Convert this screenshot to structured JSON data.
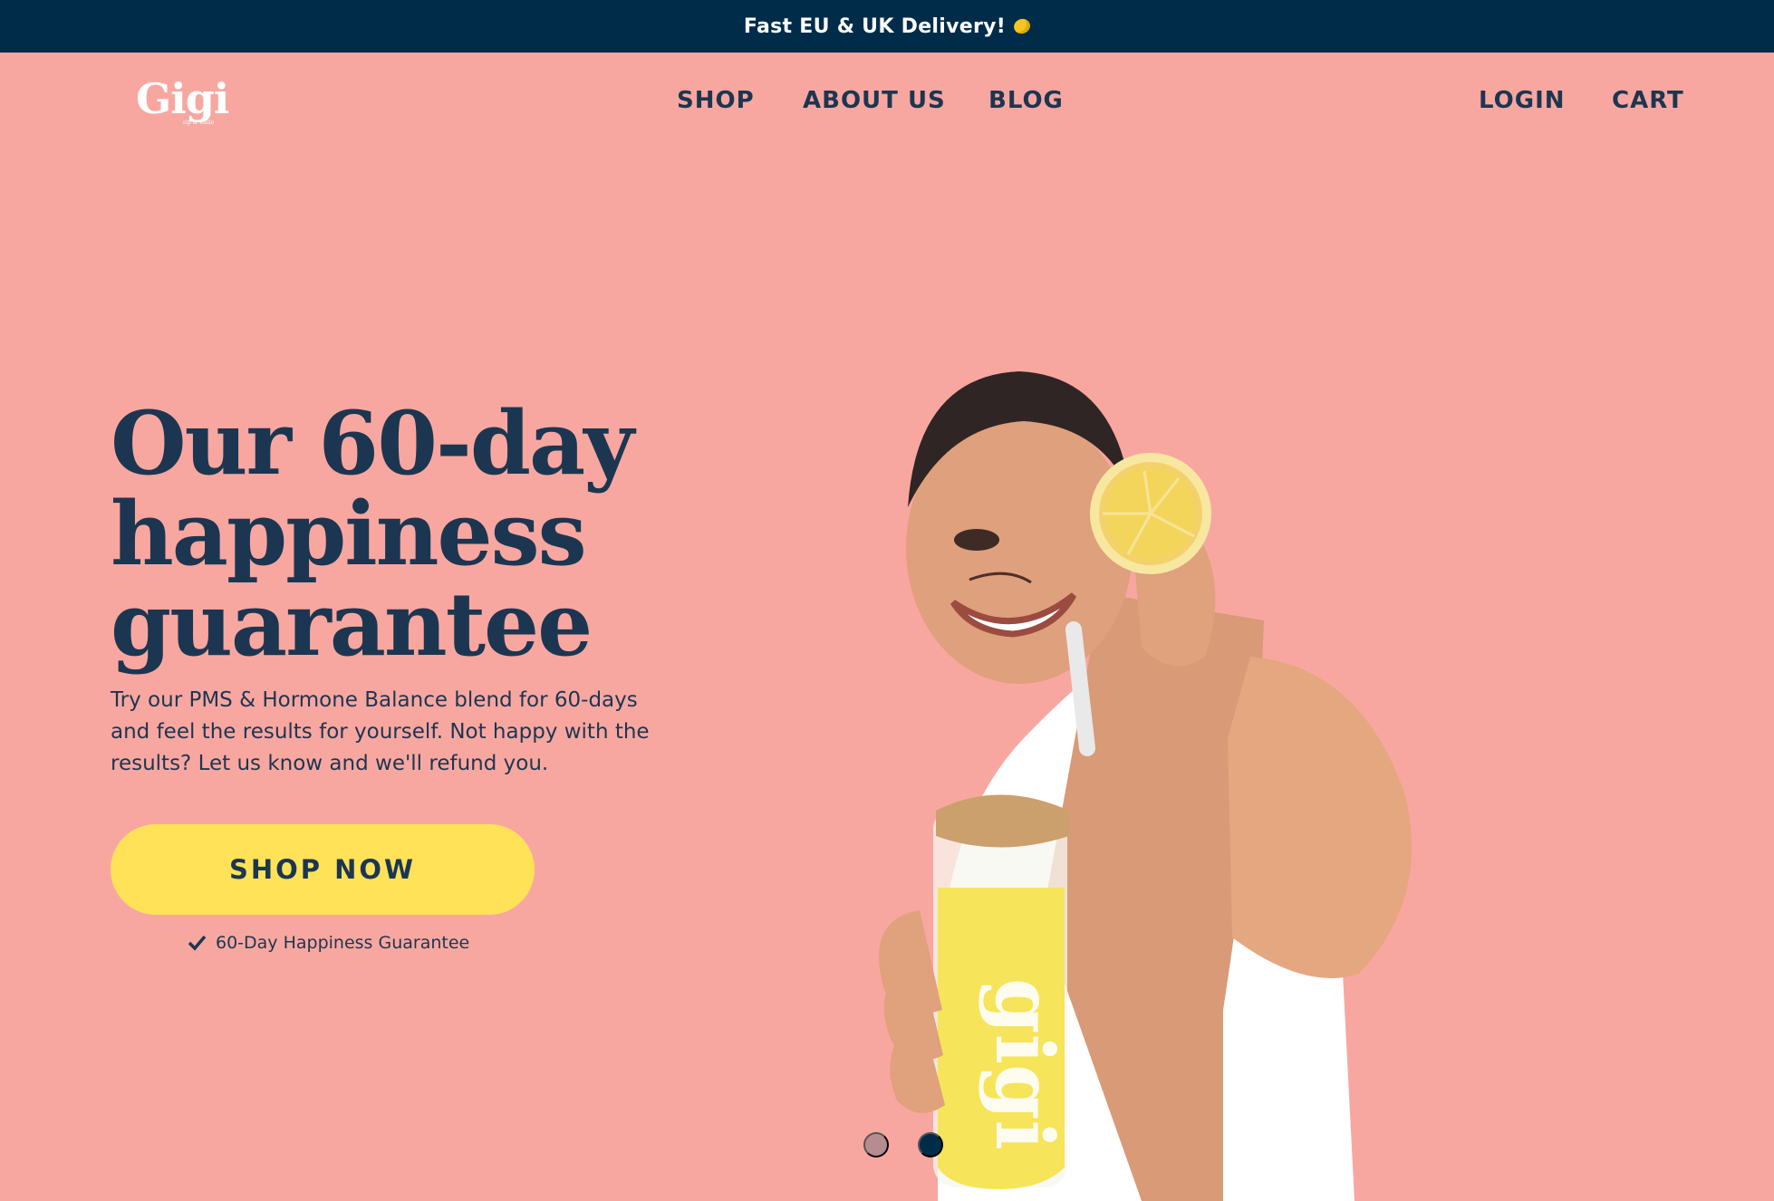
{
  "announcement": {
    "text": "Fast EU & UK Delivery!",
    "icon": "lemon-emoji-icon"
  },
  "header": {
    "logo": "Gigi",
    "nav": [
      "SHOP",
      "ABOUT US",
      "BLOG"
    ],
    "login": "LOGIN",
    "cart": "CART"
  },
  "hero": {
    "title": "Our 60-day happiness guarantee",
    "description": "Try our PMS & Hormone Balance blend for 60-days and feel the results for yourself. Not happy with the results? Let us know and we'll refund you.",
    "cta": "SHOP NOW",
    "guarantee": "60-Day Happiness Guarantee",
    "guarantee_icon": "check-icon"
  },
  "carousel": {
    "slides": 2,
    "active_slide": 2
  },
  "colors": {
    "background": "#f8a7a0",
    "navy": "#1c3651",
    "topbar": "#002c49",
    "button": "#ffe258",
    "inactive_dot": "#b58d91"
  }
}
